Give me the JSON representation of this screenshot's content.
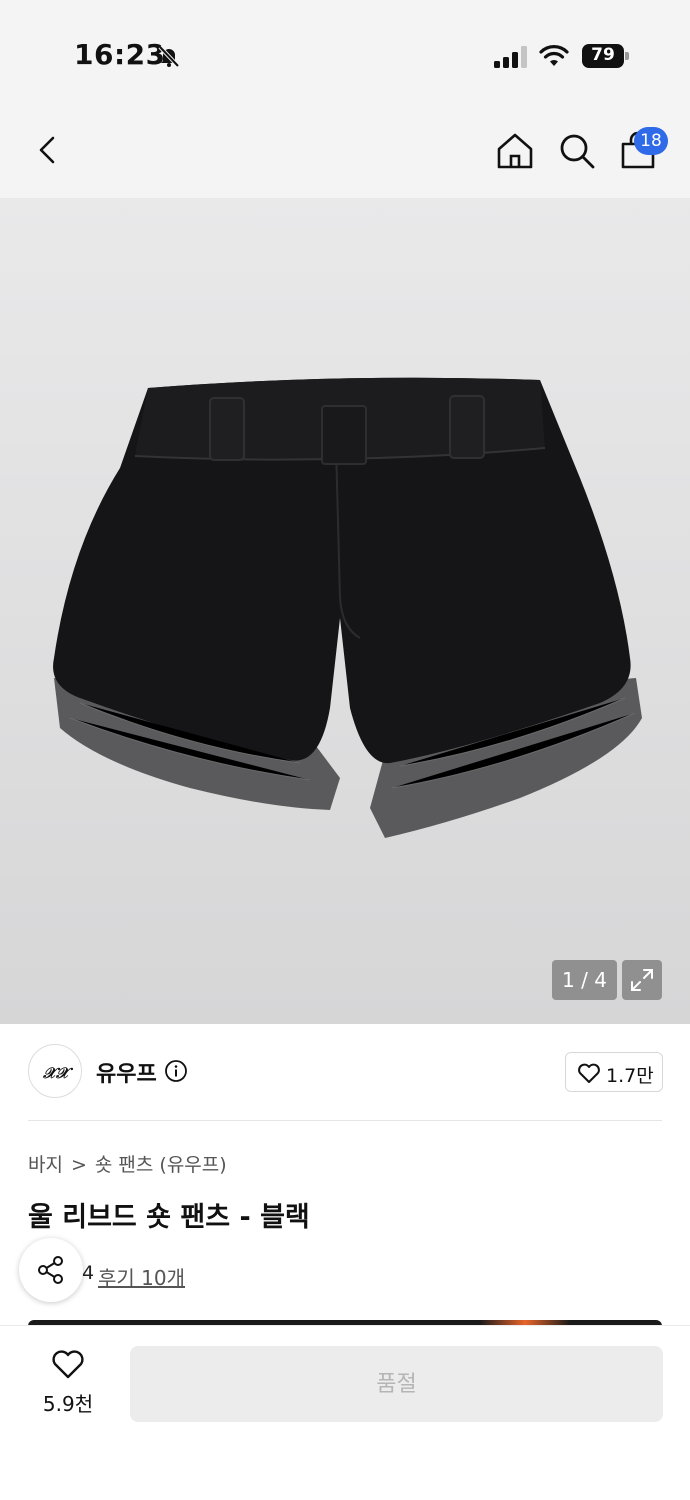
{
  "status_bar": {
    "time": "16:23",
    "battery": "79"
  },
  "nav": {
    "cart_count": "18"
  },
  "gallery": {
    "counter": "1 / 4"
  },
  "brand": {
    "name": "유우프",
    "logo_text": "𝒳𝒳",
    "likes": "1.7만"
  },
  "product": {
    "breadcrumb": [
      "바지",
      "숏 팬츠 (유우프)"
    ],
    "breadcrumb_sep": ">",
    "title": "울 리브드 숏 팬츠 - 블랙",
    "rating_fragment": "4",
    "review_link": "후기 10개"
  },
  "bottom_bar": {
    "wish_count": "5.9천",
    "action_label": "품절"
  },
  "colors": {
    "badge": "#2f6ae8",
    "disabled_button": "#ececec",
    "disabled_text": "#b5b5b5"
  }
}
